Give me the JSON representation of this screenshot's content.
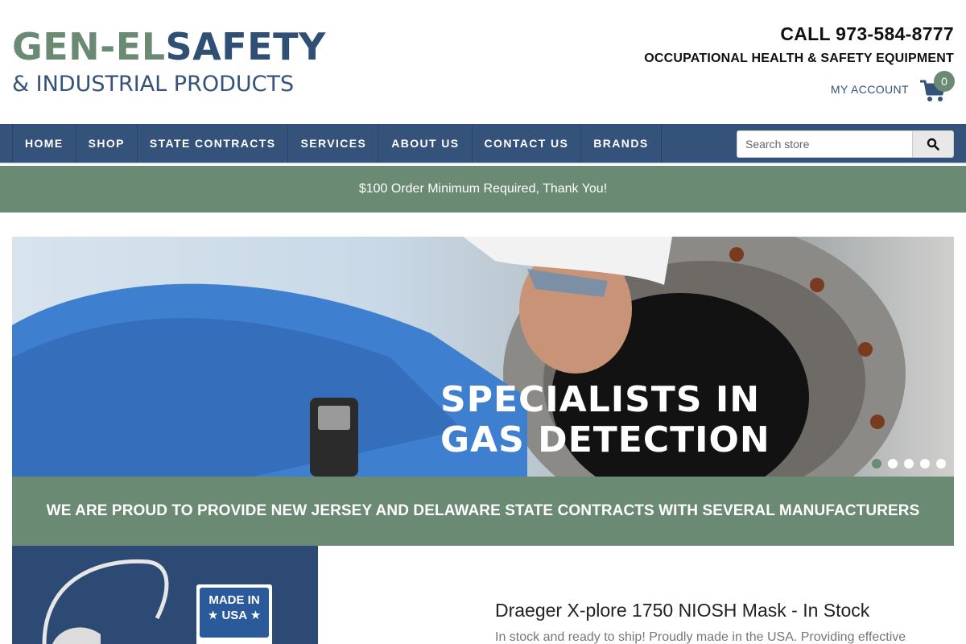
{
  "brand": {
    "name_part1": "GEN-EL",
    "name_part2": "SAFETY",
    "subtitle": "& INDUSTRIAL PRODUCTS",
    "colors": {
      "green": "#6b8a73",
      "navy": "#34527a"
    }
  },
  "header": {
    "phone": "CALL 973-584-8777",
    "tagline": "OCCUPATIONAL HEALTH & SAFETY EQUIPMENT",
    "my_account": "MY ACCOUNT",
    "cart_count": "0",
    "cart_icon": "cart-icon"
  },
  "nav": {
    "items": [
      {
        "label": "HOME"
      },
      {
        "label": "SHOP"
      },
      {
        "label": "STATE CONTRACTS"
      },
      {
        "label": "SERVICES"
      },
      {
        "label": "ABOUT US"
      },
      {
        "label": "CONTACT US"
      },
      {
        "label": "BRANDS"
      }
    ],
    "search_placeholder": "Search store",
    "search_icon": "search-icon"
  },
  "notice": "$100 Order Minimum Required, Thank You!",
  "hero": {
    "line1": "SPECIALISTS IN",
    "line2": "GAS DETECTION",
    "slide_count": 5,
    "active_slide": 1
  },
  "contracts_banner": "WE ARE PROUD TO PROVIDE NEW JERSEY AND DELAWARE STATE CONTRACTS WITH SEVERAL MANUFACTURERS",
  "product": {
    "badge_line1": "MADE IN",
    "badge_line2": "★ USA ★",
    "title": "Draeger X-plore 1750 NIOSH Mask - In Stock",
    "description": "In stock and ready to ship! Proudly made in the USA. Providing effective"
  }
}
